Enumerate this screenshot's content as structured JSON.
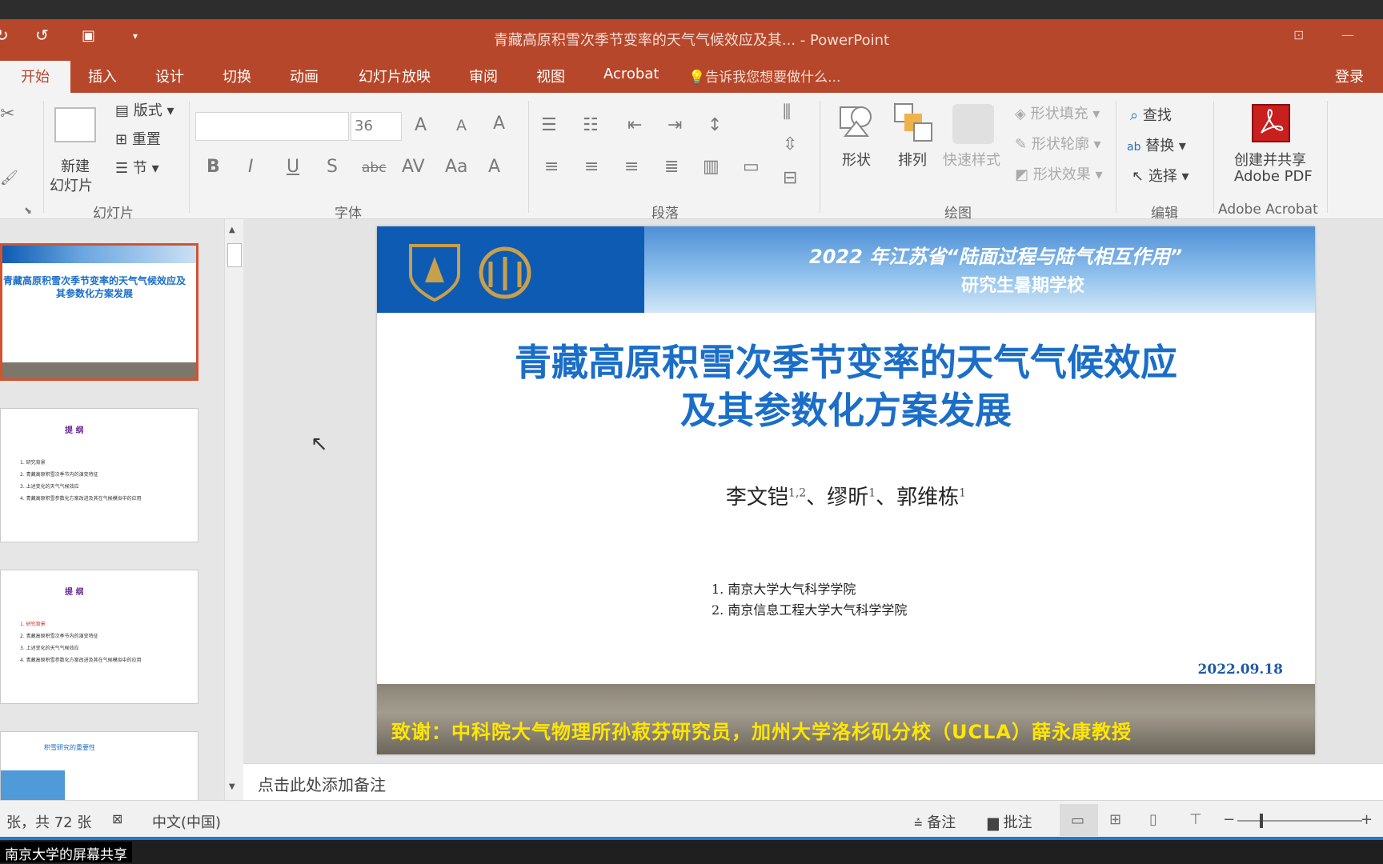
{
  "window": {
    "title": "青藏高原积雪次季节变率的天气气候效应及其... - PowerPoint"
  },
  "tabs": [
    "开始",
    "插入",
    "设计",
    "切换",
    "动画",
    "幻灯片放映",
    "审阅",
    "视图",
    "Acrobat"
  ],
  "tell_me": "告诉我您想要做什么...",
  "login": "登录",
  "ribbon": {
    "slides": {
      "new_slide_1": "新建",
      "new_slide_2": "幻灯片",
      "layout": "版式",
      "reset": "重置",
      "section": "节",
      "label": "幻灯片"
    },
    "font": {
      "size": "36",
      "label": "字体"
    },
    "paragraph": {
      "label": "段落"
    },
    "drawing": {
      "shapes": "形状",
      "arrange": "排列",
      "quick_styles": "快速样式",
      "shape_fill": "形状填充",
      "shape_outline": "形状轮廓",
      "shape_effects": "形状效果",
      "label": "绘图"
    },
    "editing": {
      "find": "查找",
      "replace": "替换",
      "select": "选择",
      "label": "编辑"
    },
    "acrobat": {
      "create_1": "创建并共享",
      "create_2": "Adobe PDF",
      "label": "Adobe Acrobat"
    }
  },
  "thumbnails": [
    {
      "kind": "title",
      "title": "青藏高原积雪次季节变率的天气气候效应及其参数化方案发展"
    },
    {
      "kind": "outline",
      "title": "提 纲",
      "items": [
        "1. 研究背景",
        "2. 青藏高原积雪次季节内的演变特征",
        "3. 上述变化的天气气候效应",
        "4. 青藏高原积雪参数化方案改进及其在气候模拟中的应用"
      ]
    },
    {
      "kind": "outline",
      "title": "提 纲",
      "items": [
        "1. 研究背景",
        "2. 青藏高原积雪次季节内的演变特征",
        "3. 上述变化的天气气候效应",
        "4. 青藏高原积雪参数化方案改进及其在气候模拟中的应用"
      ]
    },
    {
      "kind": "content",
      "title": "积雪研究的重要性"
    }
  ],
  "slide": {
    "banner_line1": "2022 年江苏省“陆面过程与陆气相互作用”",
    "banner_line2": "研究生暑期学校",
    "title_line1": "青藏高原积雪次季节变率的天气气候效应",
    "title_line2": "及其参数化方案发展",
    "authors": [
      {
        "name": "李文铠",
        "sup": "1,2"
      },
      {
        "name": "缪昕",
        "sup": "1"
      },
      {
        "name": "郭维栋",
        "sup": "1"
      }
    ],
    "author_sep": "、",
    "affiliation_1": "1. 南京大学大气科学学院",
    "affiliation_2": "2. 南京信息工程大学大气科学学院",
    "date": "2022.09.18",
    "acknowledgement": "致谢：中科院大气物理所孙菽芬研究员，加州大学洛杉矶分校（UCLA）薛永康教授"
  },
  "notes_placeholder": "点击此处添加备注",
  "status": {
    "slide_count": "张，共 72 张",
    "language": "中文(中国)",
    "notes": "备注",
    "comments": "批注"
  },
  "share_label": "南京大学的屏幕共享",
  "colors": {
    "ribbon_accent": "#b7472a",
    "title_blue": "#1a6ec8",
    "ack_yellow": "#ffe600"
  }
}
